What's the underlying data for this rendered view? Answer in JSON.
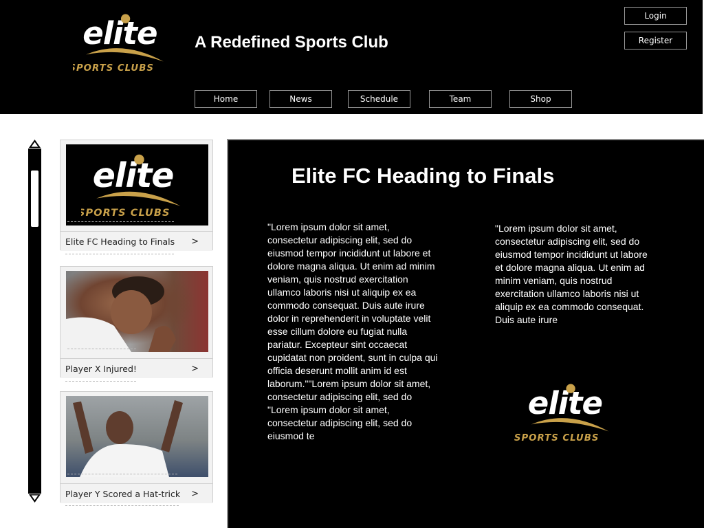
{
  "header": {
    "logo": {
      "word": "elite",
      "sub": "SPORTS CLUBS"
    },
    "tagline": "A Redefined Sports Club",
    "auth": {
      "login": "Login",
      "register": "Register"
    },
    "nav": [
      "Home",
      "News",
      "Schedule",
      "Team",
      "Shop"
    ]
  },
  "sidebar": {
    "cards": [
      {
        "caption": "Elite FC Heading to Finals",
        "chevron": ">"
      },
      {
        "caption": "Player X Injured!",
        "chevron": ">"
      },
      {
        "caption": "Player Y Scored a Hat-trick",
        "chevron": ">"
      }
    ]
  },
  "article": {
    "title": "Elite FC Heading to Finals",
    "column1": "\"Lorem ipsum dolor sit amet, consectetur adipiscing elit, sed do eiusmod tempor incididunt ut labore et dolore magna aliqua. Ut enim ad minim veniam, quis nostrud exercitation ullamco laboris nisi ut aliquip ex ea commodo consequat. Duis aute irure dolor in reprehenderit in voluptate velit esse cillum dolore eu fugiat nulla pariatur. Excepteur sint occaecat cupidatat non proident, sunt in culpa qui officia deserunt mollit anim id est laborum.\"\"Lorem ipsum dolor sit amet, consectetur adipiscing elit, sed do \"Lorem ipsum dolor sit amet, consectetur adipiscing elit, sed do eiusmod te",
    "column2": "\"Lorem ipsum dolor sit amet, consectetur adipiscing elit, sed do eiusmod tempor incididunt ut labore et dolore magna aliqua. Ut enim ad minim veniam, quis nostrud exercitation ullamco laboris nisi ut aliquip ex ea commodo consequat. Duis aute irure"
  },
  "colors": {
    "background": "#000000",
    "text": "#ffffff",
    "accent_gold": "#c9a14a",
    "button_border": "#9a9a9a",
    "card_bg": "#f2f2f2"
  },
  "icons": {
    "scroll_up": "triangle-up-icon",
    "scroll_down": "triangle-down-icon",
    "chevron": "chevron-right-icon"
  }
}
